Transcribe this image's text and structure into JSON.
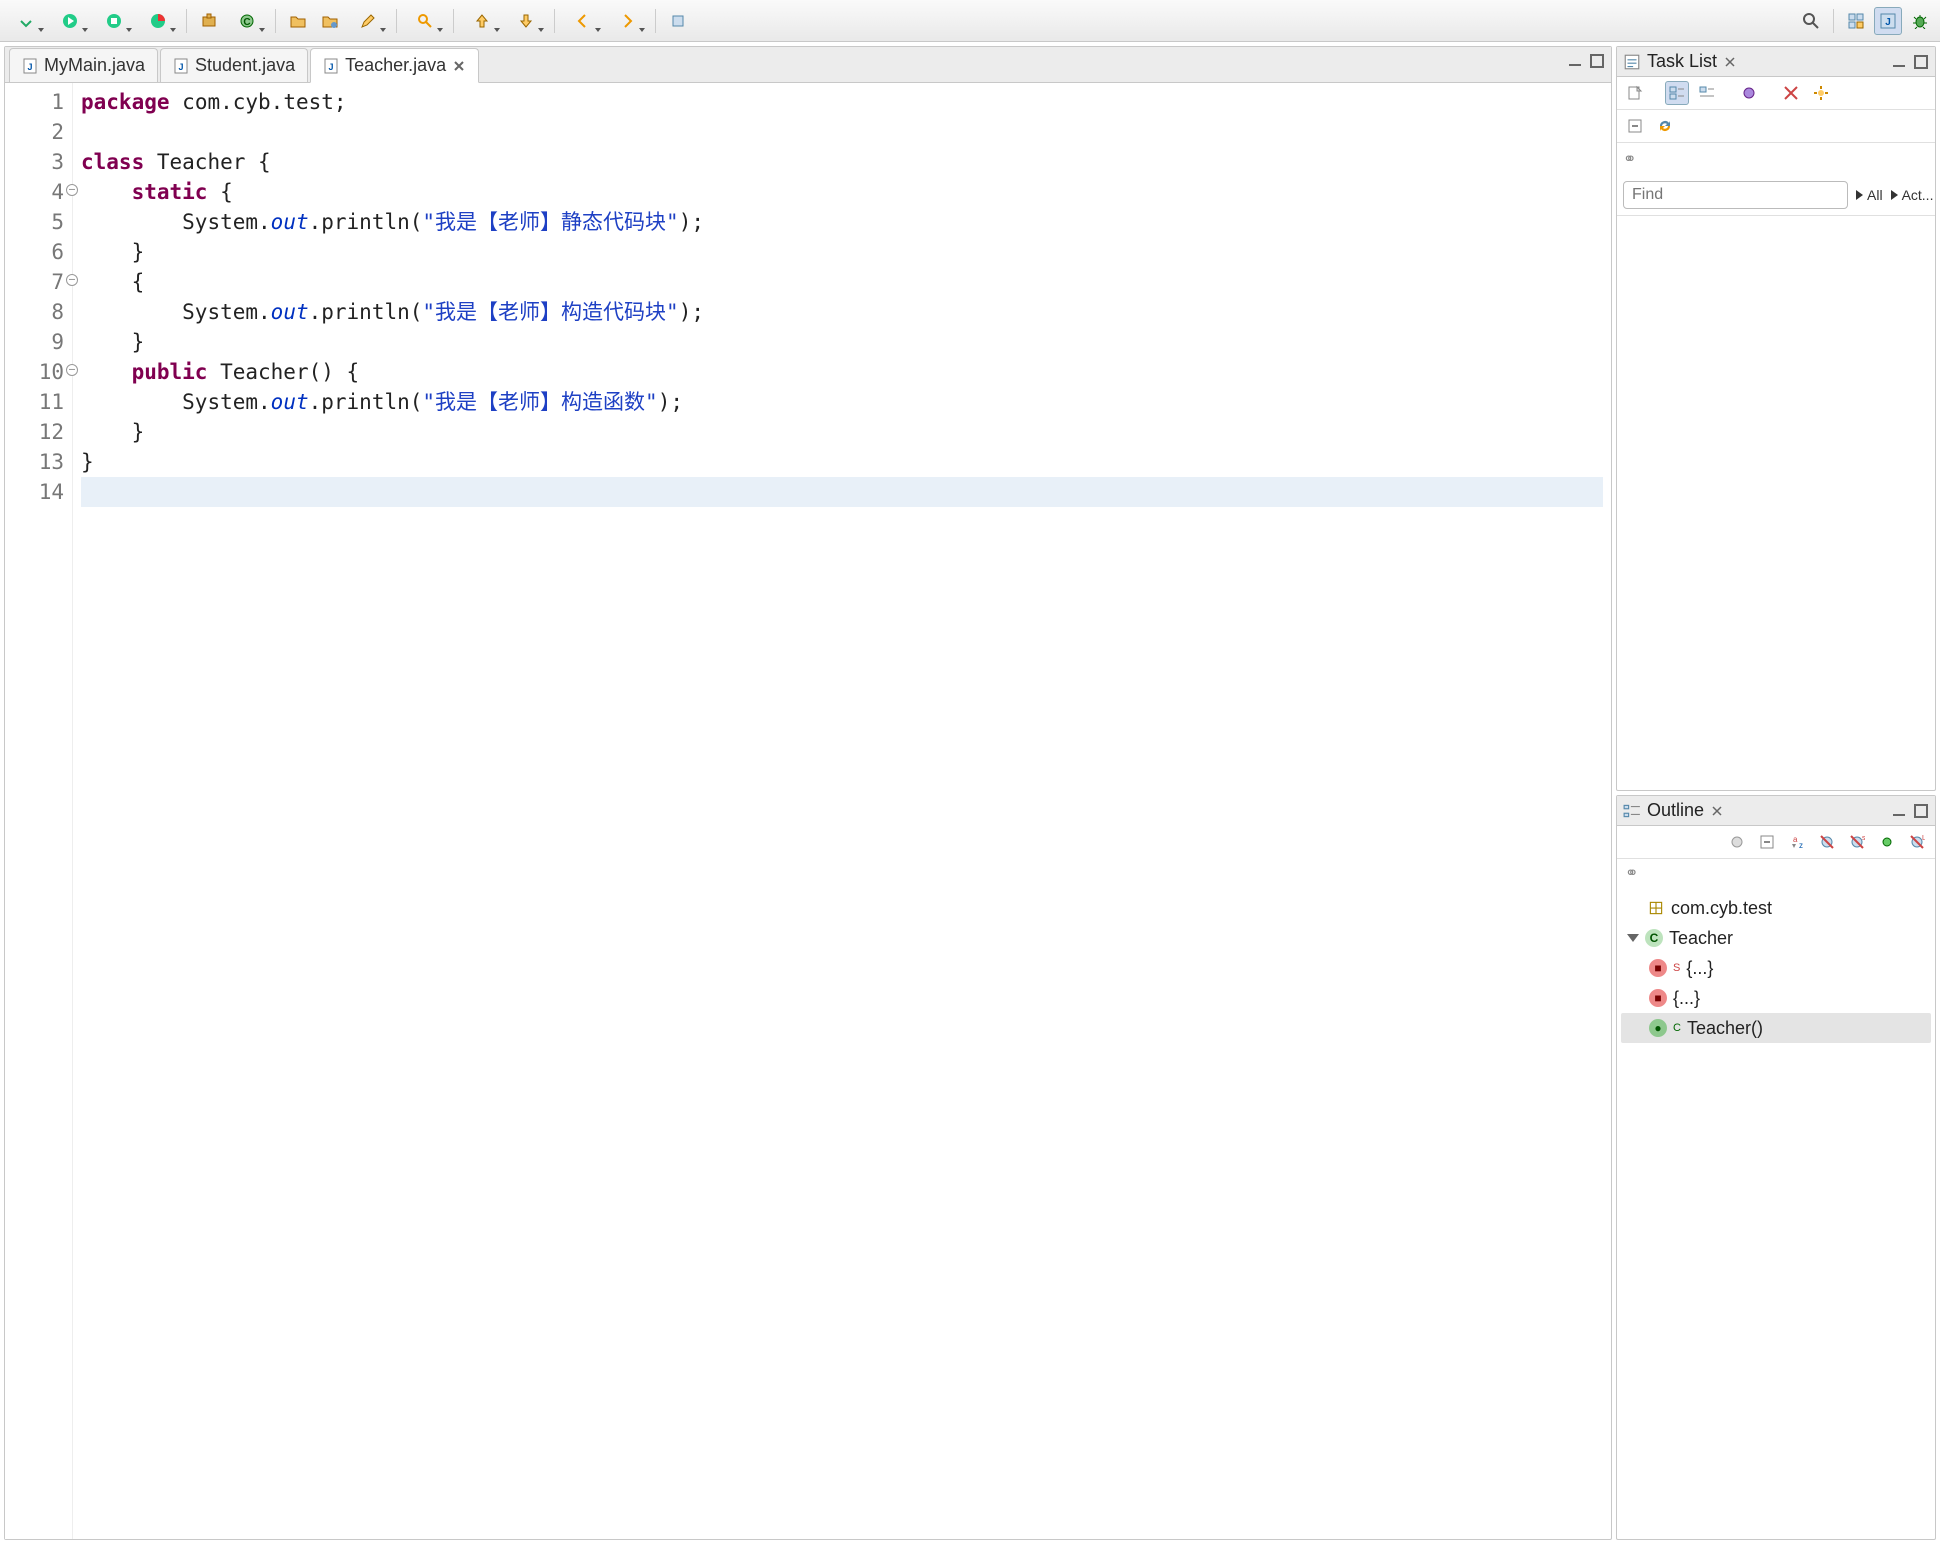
{
  "toolbar": {
    "search_tooltip": "Search"
  },
  "tabs": [
    {
      "label": "MyMain.java",
      "active": false
    },
    {
      "label": "Student.java",
      "active": false
    },
    {
      "label": "Teacher.java",
      "active": true
    }
  ],
  "editor": {
    "lines": [
      {
        "n": 1,
        "html": "<span class='kw'>package</span> <span class='pln'>com.cyb.test;</span>"
      },
      {
        "n": 2,
        "html": ""
      },
      {
        "n": 3,
        "html": "<span class='kw'>class</span> <span class='typ'>Teacher</span> <span class='pln'>{</span>"
      },
      {
        "n": 4,
        "html": "    <span class='kw'>static</span> <span class='pln'>{</span>",
        "fold": true
      },
      {
        "n": 5,
        "html": "        <span class='pln'>System.</span><span class='fld'>out</span><span class='pln'>.println(</span><span class='str'>\"我是【老师】静态代码块\"</span><span class='pln'>);</span>"
      },
      {
        "n": 6,
        "html": "    <span class='pln'>}</span>"
      },
      {
        "n": 7,
        "html": "    <span class='pln'>{</span>",
        "fold": true
      },
      {
        "n": 8,
        "html": "        <span class='pln'>System.</span><span class='fld'>out</span><span class='pln'>.println(</span><span class='str'>\"我是【老师】构造代码块\"</span><span class='pln'>);</span>"
      },
      {
        "n": 9,
        "html": "    <span class='pln'>}</span>"
      },
      {
        "n": 10,
        "html": "    <span class='kw'>public</span> <span class='pln'>Teacher() {</span>",
        "fold": true
      },
      {
        "n": 11,
        "html": "        <span class='pln'>System.</span><span class='fld'>out</span><span class='pln'>.println(</span><span class='str'>\"我是【老师】构造函数\"</span><span class='pln'>);</span>"
      },
      {
        "n": 12,
        "html": "    <span class='pln'>}</span>"
      },
      {
        "n": 13,
        "html": "<span class='pln'>}</span>"
      },
      {
        "n": 14,
        "html": "",
        "hl": true
      }
    ]
  },
  "tasklist": {
    "title": "Task List",
    "find_placeholder": "Find",
    "links": {
      "all": "All",
      "act": "Act..."
    }
  },
  "outline": {
    "title": "Outline",
    "items": {
      "package": "com.cyb.test",
      "class": "Teacher",
      "static_block": "{...}",
      "init_block": "{...}",
      "constructor": "Teacher()"
    }
  }
}
